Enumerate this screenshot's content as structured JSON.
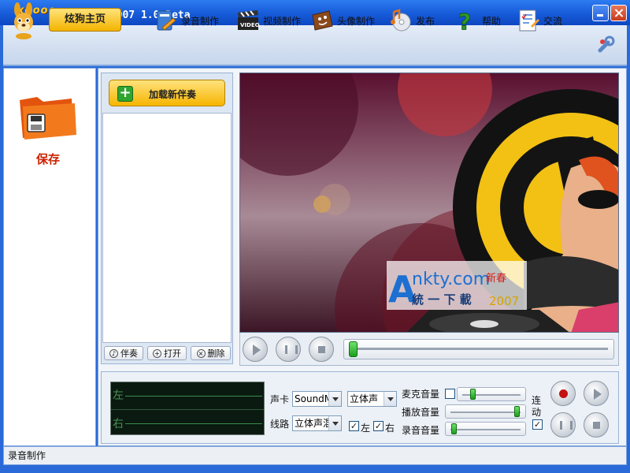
{
  "window": {
    "logo": "xgooo",
    "title": "炫狗 2007 1.0 Beta"
  },
  "toolbar": {
    "home_label": "炫狗主页",
    "items": [
      {
        "label": "录音制作",
        "icon": "microphone-doc-icon"
      },
      {
        "label": "视频制作",
        "icon": "video-clapper-icon"
      },
      {
        "label": "头像制作",
        "icon": "avatar-icon"
      },
      {
        "label": "发布",
        "icon": "cd-music-icon"
      },
      {
        "label": "帮助",
        "icon": "question-mark-icon"
      },
      {
        "label": "交流",
        "icon": "notes-icon"
      }
    ],
    "tools_icon": "wrench-icon"
  },
  "sidebar": {
    "save_label": "保存"
  },
  "playlist": {
    "load_button": "加载新伴奏",
    "buttons": [
      "伴奏",
      "打开",
      "删除"
    ]
  },
  "video": {
    "watermark_main": "nkty.com",
    "watermark_sub": "統 一 下 載",
    "watermark_year": "2007",
    "watermark_badge": "新春"
  },
  "recorder": {
    "meter_left": "左",
    "meter_right": "右",
    "soundcard_label": "声卡",
    "soundcard_value": "SoundM",
    "stereo_value": "立体声",
    "line_label": "线路",
    "line_value": "立体声混",
    "left_check": "左",
    "right_check": "右",
    "mic_volume_label": "麦克音量",
    "play_volume_label": "播放音量",
    "rec_volume_label": "录音音量",
    "link_label_1": "连",
    "link_label_2": "动",
    "mic_volume": 0.18,
    "play_volume": 0.97,
    "rec_volume": 0.05,
    "seek_position": 0.0
  },
  "status": {
    "text": "录音制作"
  },
  "colors": {
    "title_blue": "#1558d6",
    "accent_yellow": "#f6b500",
    "save_red": "#cc2200",
    "slider_green": "#1a9f1a"
  }
}
